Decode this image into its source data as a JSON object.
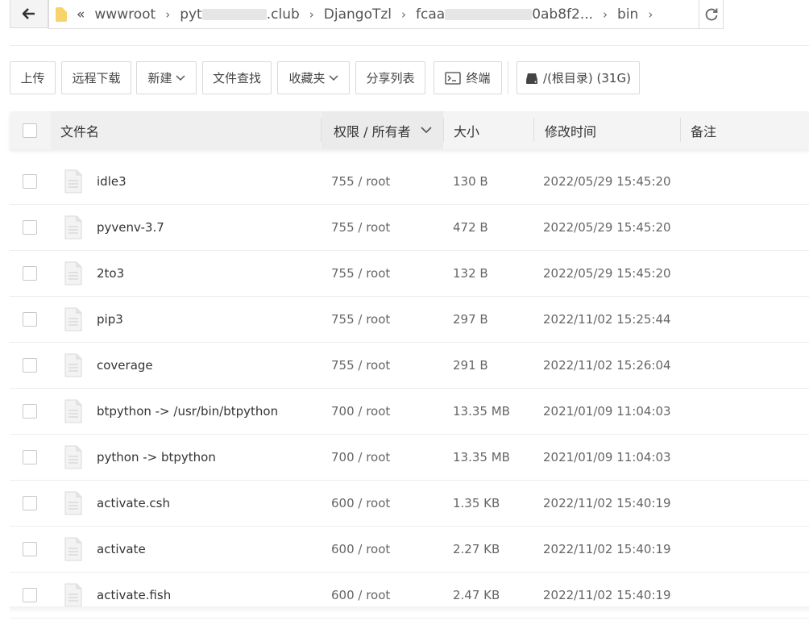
{
  "address": {
    "crumbs": [
      "wwwroot",
      "pyt",
      ".club",
      "DjangoTzl",
      "fcaa",
      "0ab8f2...",
      "bin"
    ]
  },
  "toolbar": {
    "upload": "上传",
    "remote_download": "远程下载",
    "new": "新建",
    "file_search": "文件查找",
    "favorites": "收藏夹",
    "share_list": "分享列表",
    "terminal": "终端",
    "disk": "/(根目录) (31G)"
  },
  "table": {
    "headers": {
      "filename": "文件名",
      "perm": "权限 / 所有者",
      "size": "大小",
      "mtime": "修改时间",
      "note": "备注"
    },
    "rows": [
      {
        "name": "idle3",
        "perm": "755 / root",
        "size": "130 B",
        "mtime": "2022/05/29 15:45:20"
      },
      {
        "name": "pyvenv-3.7",
        "perm": "755 / root",
        "size": "472 B",
        "mtime": "2022/05/29 15:45:20"
      },
      {
        "name": "2to3",
        "perm": "755 / root",
        "size": "132 B",
        "mtime": "2022/05/29 15:45:20"
      },
      {
        "name": "pip3",
        "perm": "755 / root",
        "size": "297 B",
        "mtime": "2022/11/02 15:25:44"
      },
      {
        "name": "coverage",
        "perm": "755 / root",
        "size": "291 B",
        "mtime": "2022/11/02 15:26:04"
      },
      {
        "name": "btpython -> /usr/bin/btpython",
        "perm": "700 / root",
        "size": "13.35 MB",
        "mtime": "2021/01/09 11:04:03"
      },
      {
        "name": "python -> btpython",
        "perm": "700 / root",
        "size": "13.35 MB",
        "mtime": "2021/01/09 11:04:03"
      },
      {
        "name": "activate.csh",
        "perm": "600 / root",
        "size": "1.35 KB",
        "mtime": "2022/11/02 15:40:19"
      },
      {
        "name": "activate",
        "perm": "600 / root",
        "size": "2.27 KB",
        "mtime": "2022/11/02 15:40:19"
      },
      {
        "name": "activate.fish",
        "perm": "600 / root",
        "size": "2.47 KB",
        "mtime": "2022/11/02 15:40:19"
      }
    ]
  }
}
